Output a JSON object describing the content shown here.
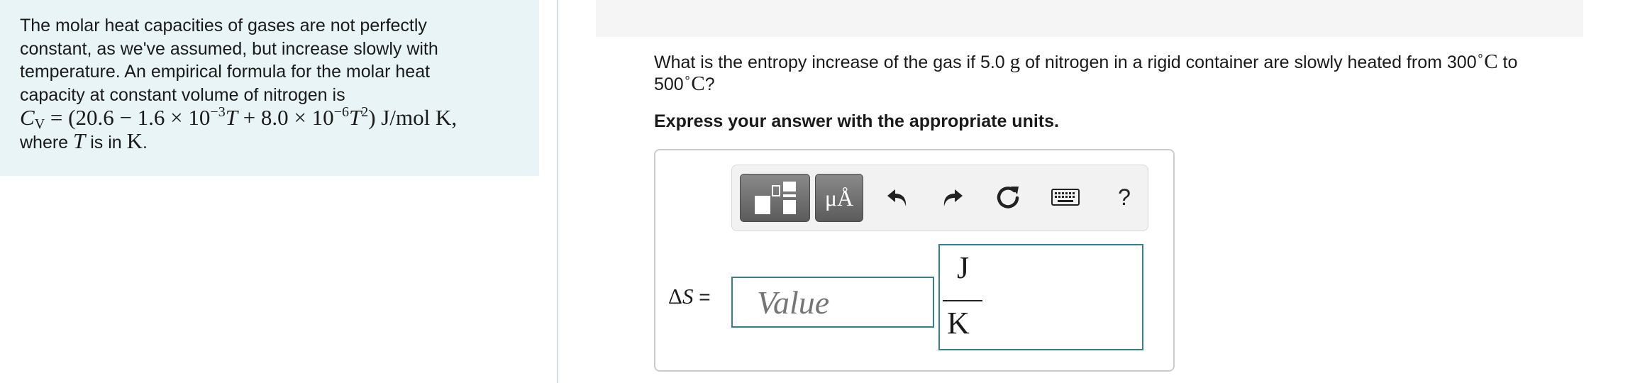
{
  "info": {
    "line1": "The molar heat capacities of gases are not perfectly",
    "line2": "constant, as we've assumed, but increase slowly with",
    "line3": "temperature. An empirical formula for the molar heat",
    "line4": "capacity at constant volume of nitrogen is",
    "formula": {
      "c": "C",
      "sub_v": "V",
      "part1": " = (20.6 − 1.6 × 10",
      "exp1": "−3",
      "t1": "T",
      "part2": " + 8.0 × 10",
      "exp2": "−6",
      "t2": "T",
      "exp3": "2",
      "part3": ") J/mol K,"
    },
    "where": "where ",
    "where_t": "T",
    "where_mid": " is in ",
    "where_k": "K",
    "where_end": "."
  },
  "question": {
    "text1": "What is the entropy increase of the gas if 5.0 ",
    "g": "g",
    "text2": " of nitrogen in a rigid container are slowly heated from 300",
    "deg1": "∘",
    "c1": "C",
    "text3": " to",
    "text4": "500",
    "deg2": "∘",
    "c2": "C",
    "text5": "?"
  },
  "instruction": "Express your answer with the appropriate units.",
  "toolbar": {
    "units_label": "μÅ",
    "help_label": "?"
  },
  "answer": {
    "delta": "Δ",
    "s": "S",
    "equals": " =",
    "placeholder": "Value",
    "unit_numerator": "J",
    "unit_denominator": "K"
  }
}
